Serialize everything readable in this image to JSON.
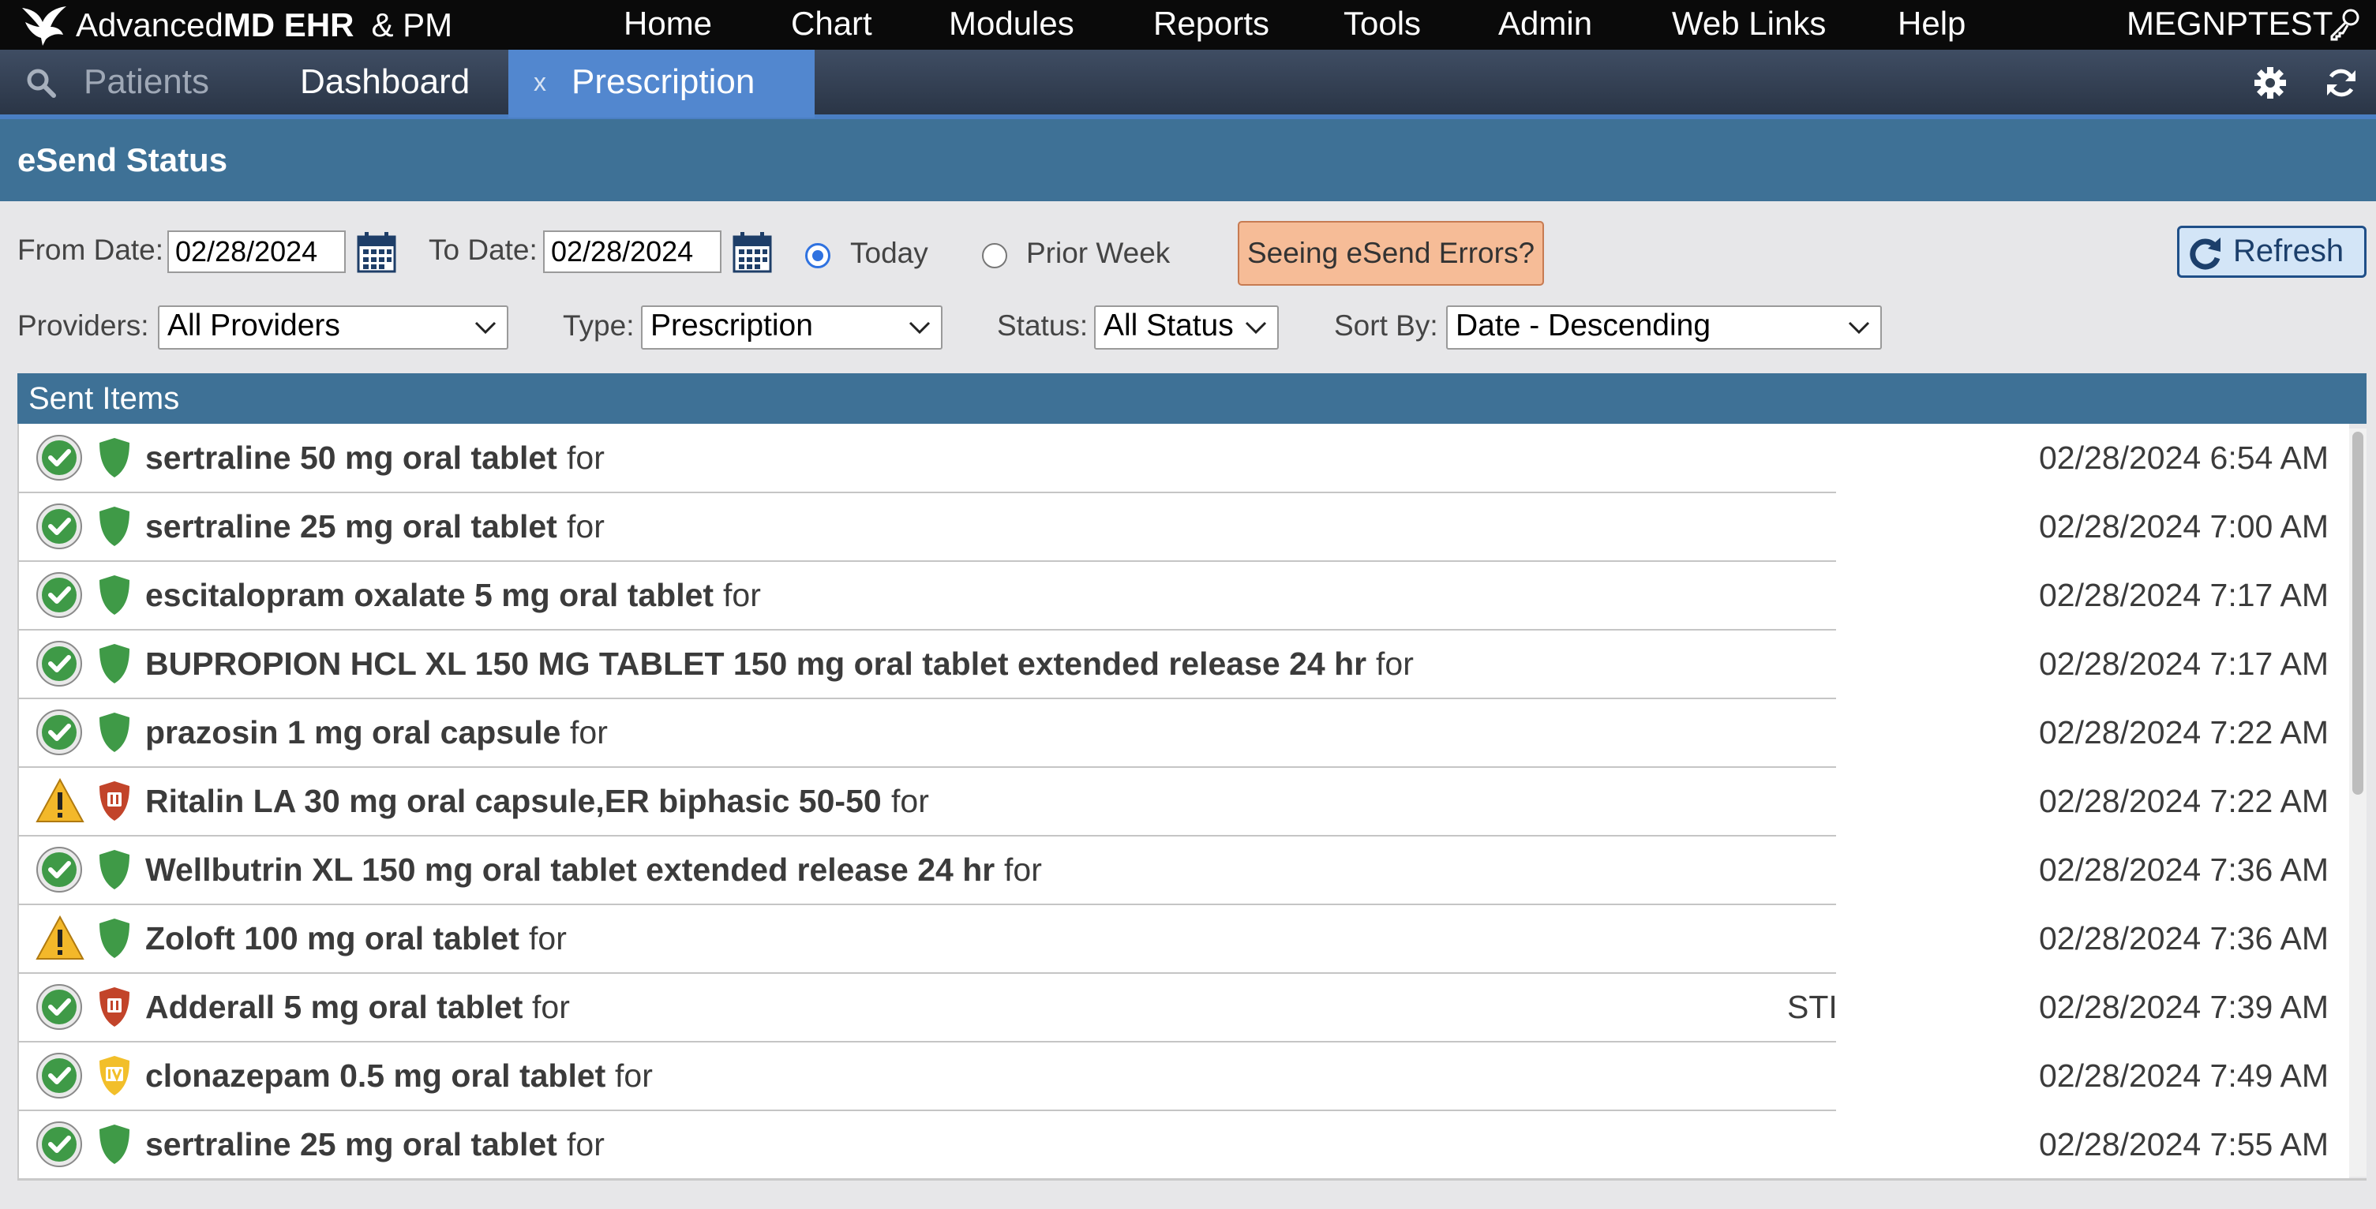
{
  "app": {
    "brand_regular": "Advanced",
    "brand_bold": "MD EHR",
    "brand_suffix": "&  PM"
  },
  "top_menu": [
    "Home",
    "Chart",
    "Modules",
    "Reports",
    "Tools",
    "Admin",
    "Web Links",
    "Help"
  ],
  "user": "MEGNPTEST",
  "tabs": {
    "patients": "Patients",
    "dashboard": "Dashboard",
    "prescription": "Prescription",
    "close_glyph": "x"
  },
  "section_title": "eSend Status",
  "filters": {
    "from_label": "From Date:",
    "from_value": "02/28/2024",
    "to_label": "To Date:",
    "to_value": "02/28/2024",
    "today_label": "Today",
    "prior_week_label": "Prior Week",
    "selected_range": "Today",
    "errors_button": "Seeing eSend Errors?",
    "refresh_button": "Refresh",
    "providers_label": "Providers:",
    "providers_value": "All Providers",
    "type_label": "Type:",
    "type_value": "Prescription",
    "status_label": "Status:",
    "status_value": "All Status",
    "sort_label": "Sort By:",
    "sort_value": "Date - Descending"
  },
  "list_title": "Sent Items",
  "colors": {
    "header_blue": "#3e7196",
    "tab_active": "#5287cf",
    "success_green": "#3f9a47",
    "warning_yellow": "#f3b82a",
    "schedule_ii_red": "#c2442a",
    "schedule_iv_yellow": "#f2bf2a"
  },
  "items": [
    {
      "name": "sertraline 50 mg oral tablet",
      "suffix": "for",
      "extra": "",
      "date": "02/28/2024 6:54 AM",
      "status_icon": "check-circle-icon",
      "schedule_icon": "shield-icon"
    },
    {
      "name": "sertraline 25 mg oral tablet",
      "suffix": "for",
      "extra": "",
      "date": "02/28/2024 7:00 AM",
      "status_icon": "check-circle-icon",
      "schedule_icon": "shield-icon"
    },
    {
      "name": "escitalopram oxalate 5 mg oral tablet",
      "suffix": "for",
      "extra": "",
      "date": "02/28/2024 7:17 AM",
      "status_icon": "check-circle-icon",
      "schedule_icon": "shield-icon"
    },
    {
      "name": "BUPROPION HCL XL 150 MG TABLET 150 mg oral tablet extended release 24 hr",
      "suffix": "for",
      "extra": "",
      "date": "02/28/2024 7:17 AM",
      "status_icon": "check-circle-icon",
      "schedule_icon": "shield-icon"
    },
    {
      "name": "prazosin 1 mg oral capsule",
      "suffix": "for",
      "extra": "",
      "date": "02/28/2024 7:22 AM",
      "status_icon": "check-circle-icon",
      "schedule_icon": "shield-icon"
    },
    {
      "name": "Ritalin LA 30 mg oral capsule,ER biphasic 50-50",
      "suffix": "for",
      "extra": "",
      "date": "02/28/2024 7:22 AM",
      "status_icon": "warning-icon",
      "schedule_icon": "schedule-ii-shield-icon"
    },
    {
      "name": "Wellbutrin XL 150 mg oral tablet extended release 24 hr",
      "suffix": "for",
      "extra": "",
      "date": "02/28/2024 7:36 AM",
      "status_icon": "check-circle-icon",
      "schedule_icon": "shield-icon"
    },
    {
      "name": "Zoloft 100 mg oral tablet",
      "suffix": "for",
      "extra": "",
      "date": "02/28/2024 7:36 AM",
      "status_icon": "warning-icon",
      "schedule_icon": "shield-icon"
    },
    {
      "name": "Adderall 5 mg oral tablet",
      "suffix": "for",
      "extra": "STI",
      "date": "02/28/2024 7:39 AM",
      "status_icon": "check-circle-icon",
      "schedule_icon": "schedule-ii-shield-icon"
    },
    {
      "name": "clonazepam 0.5 mg oral tablet",
      "suffix": "for",
      "extra": "",
      "date": "02/28/2024 7:49 AM",
      "status_icon": "check-circle-icon",
      "schedule_icon": "schedule-iv-shield-icon"
    },
    {
      "name": "sertraline 25 mg oral tablet",
      "suffix": "for",
      "extra": "",
      "date": "02/28/2024 7:55 AM",
      "status_icon": "check-circle-icon",
      "schedule_icon": "shield-icon"
    }
  ]
}
